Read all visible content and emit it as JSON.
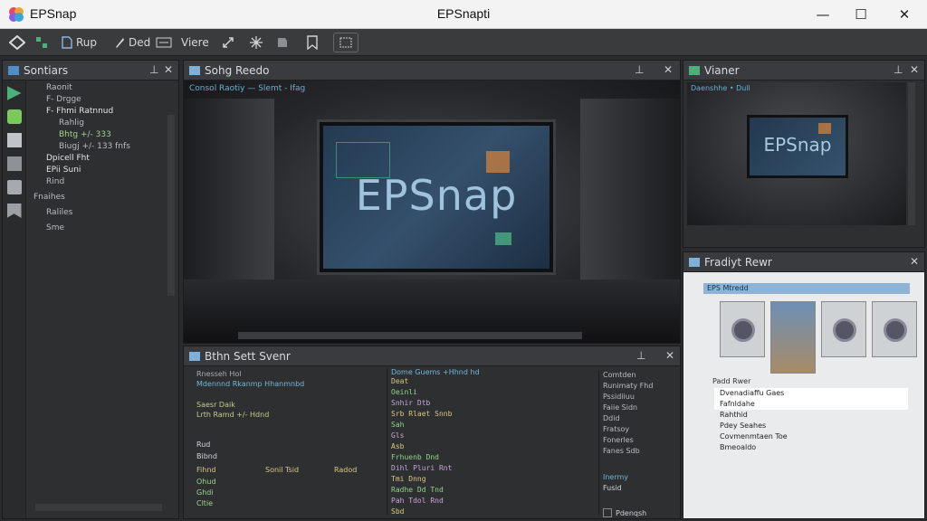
{
  "window": {
    "app_name": "EPSnap",
    "document_title": "EPSnapti",
    "minimize": "—",
    "maximize": "☐",
    "close": "✕"
  },
  "toolbar": {
    "rup_label": "Rup",
    "ded_label": "Ded",
    "view_label": "Viere"
  },
  "scene_panel": {
    "title": "Sontiars",
    "items": [
      "Raonit",
      "F- Drgge",
      "F- Fhmi Ratnnud",
      "Rahlig",
      "Bhtg  +/- 333",
      "Biugj  +/- 133 fnfs",
      "Dpicell Fht",
      "EPii Suni",
      "Rind",
      "Fnaihes",
      "Raliles",
      "Sme"
    ]
  },
  "viewport": {
    "title": "Sohg Reedo",
    "breadcrumb": "Consol Raotiy — Slemt - Ifag",
    "screen_text": "EPSnap"
  },
  "bottom_panel": {
    "title": "Bthn Sett Svenr",
    "left_header": "Rnesseh Hol",
    "left_sub": "Mdennnd Rkanmp  Hhanmnbd",
    "left_rows": [
      "Saesr Daik",
      "Lrth Ramd  +/-  Hdnd"
    ],
    "left_footer": [
      "Rud",
      "Bibnd"
    ],
    "table": {
      "cols": [
        "Fihnd",
        "Sonil Tsid",
        "Radod"
      ],
      "rows": [
        [
          "Ohud",
          "",
          ""
        ],
        [
          "Ghdi",
          "",
          ""
        ],
        [
          "Cltie",
          "",
          ""
        ]
      ]
    },
    "code_header": "Dome Guems  +Hhnd hd",
    "code_lines": [
      "Deat",
      "  Oeinli",
      "  Snhir  Dtb",
      "  Srb Rlaet Snnb",
      "   Sah",
      "    Gls",
      "     Asb",
      "      Frhuenb  Dnd",
      "       Dihl Pluri Rnt",
      "        Tmi  Dnng",
      "        Radhe Dd  Tnd",
      "         Pah Tdol  Rnd",
      "          Sbd"
    ],
    "props": [
      "Comtden",
      "Runimaty Fhd",
      "Pssidiiuu",
      "Faiie Sidn",
      "Ddid",
      "Fratsoy",
      "Fonerles",
      "Fanes Sdb"
    ],
    "side_label": "Inermy",
    "side_sub": "Fusid",
    "side_button": "Pdenqsh"
  },
  "viewer_panel": {
    "title": "Vianer",
    "breadcrumb": "Daenshhe  • Dull",
    "screen_text": "EPSnap"
  },
  "project_panel": {
    "title": "Fradiyt Rewr",
    "filter": "EPS Mtredd",
    "section": "Padd Rwer",
    "list": [
      "Dvenadiaffu Gaes",
      "Fafnldahe",
      "Rahthid",
      "Pdey Seahes",
      "Covmenmtaen Toe",
      "Bmeoaldo"
    ]
  }
}
